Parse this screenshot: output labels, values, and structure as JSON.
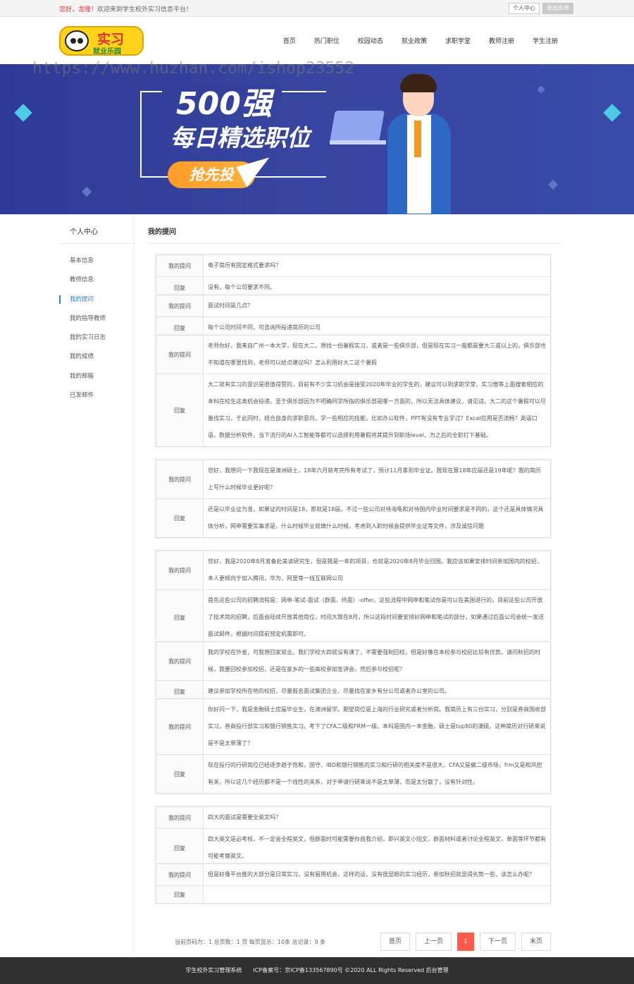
{
  "topbar": {
    "greeting_hi": "您好，",
    "greeting_name": "龙隆！",
    "greeting_text": "欢迎来到学生校外实习信息平台！",
    "personal_center": "个人中心",
    "logout": "退出系统"
  },
  "watermark": "https://www.huzhan.com/ishop23552",
  "nav": [
    "首页",
    "热门职位",
    "校园动态",
    "就业政策",
    "求职学堂",
    "教师注册",
    "学生注册"
  ],
  "banner": {
    "title1": "500强",
    "title2": "每日精选职位",
    "button": "抢先投"
  },
  "sidebar": {
    "title": "个人中心",
    "items": [
      "基本信息",
      "教师信息",
      "我的提问",
      "我的指导教师",
      "我的实习日志",
      "我的成绩",
      "我的邮箱",
      "已发邮件"
    ]
  },
  "main": {
    "title": "我的提问",
    "label_q": "我的提问",
    "label_a": "回复",
    "qa": [
      {
        "q": "电子简历有固定格式要求吗？",
        "a": "没有，每个公司要求不同。"
      },
      {
        "q": "面试时间是几点？",
        "a": "每个公司时间不同，可咨询所投递简历的公司"
      },
      {
        "q": "老师你好，我来自广州一本大学，现在大二，想找一份暑假实习，或者是一些俱乐部，但是现在实习一般都是要大三或以上的，俱乐部也不知道在哪里找到，老师可以给点建议吗？怎么利用好大二这个暑假",
        "a": "大二就有实习的意识是很值得赞的，目前有不少实习机会是接受2020年毕业的学生的，建议可以到求职学堂、实习僧等上面搜索相应的本科在校生这类机会投递。至于俱乐部因为不明确同学所指的俱乐部是哪一方面的，所以无法具体建议，请见谅。大二的这个暑假可以尽量找实习，于此同时，结合自身的求职意向，学一些相应的技能，比如办公软件，PPT有没有专业学过？Excel应用是否流畅？英语口语，数据分析软件，当下流行的AI人工智能等都可以选择利用暑假将其提升到职场level，为之后的全职打下基础。"
      },
      {
        "q": "您好，我想问一下我现在是澳洲硕士，18年六月就考完所有考试了，预计11月拿到毕业证。我现在算18年应届还是19年呢？我的简历上写什么时候毕业更好呢？",
        "a": "还是以毕业证为准，如果证的时间是18，那就是18届，不过一些公司对待海龟和对待国内毕业时间要求是不同的，这个还是具体情况具体分析，网申需要实事求是，什么时候毕业就填什么时候，考虑到入职时候会提供毕业证等文件，涉及诚信问题"
      },
      {
        "q": "您好，我是2020年8月准备赴美读研究生，但是我是一年的项目，也就是2020年8月毕业回国。我应该如果安排时间参加国内的校招，本人更倾向于加入腾讯，华为，阿里等一线互联网公司",
        "a": "首先这些公司的招聘流程是：网申-笔试-面试（群面、终面）-offer。这些流程中网申和笔试你是可以在美国进行的，目前这些公司开放了技术岗的招聘，后面会陆续开放其他岗位，时间大致在8月，所以这段时间要安排好网申和笔试的部分，如果通过后面公司会统一发送面试邮件，根据时间提前预定机票即可。"
      },
      {
        "q": "我的学校在外省，可我想回家就业。我们学校大四就没有课了，不需要强制回校。但是好像在本校参与校招比较有优势。请问秋招的时候，我要回校参加校招，还是在家乡的一些高校参加宣讲会，然后参与校招呢？",
        "a": "建议参加学校所在地的校招，尽量报名面试集团企业，尽量找在家乡有分公司或者办公室的公司。"
      },
      {
        "q": "你好问一下，我是金融硕士应届毕业生，在澳洲留学。期望岗位是上海的行业研究或者分析岗。我简历上有三份实习，分别是券商国收部实习，券商投行部实习和银行销售实习。考下了CFA二级和FRM一级。本科是国内一本金融，硕士是top80的澳硕。这种简历对行研来说是不是太单薄了？",
        "a": "现在投行的行研岗位已经逐步趋于饱和，国守、IBD和银行销售的实习和行研的相关度不是很大，CFA又是偏二级市场，frm又是和风控有关，所以这几个经历都不是一个线性的关系，对于申请行研来说不是太单薄，而是太分散了，没有针对性。"
      },
      {
        "q": "四大的面试是需要全英文吗？",
        "a": "四大英文是必考核，不一定会全程英文，但群面时可能需要你自我介绍，即兴英文小短文，群面材料或者讨论全程英文，单面等环节都有可能考察英文。"
      },
      {
        "q": "但是好像平台推的大部分是日常实习，没有留用机会，这样的话，没有很显眼的实习经历，参加秋招就显得劣势一些，该怎么办呢？",
        "a": ""
      }
    ]
  },
  "pager": {
    "info": "当前页码为：1 总页数：1 页 每页显示：10条 总记录：9 条",
    "first": "首页",
    "prev": "上一页",
    "current": "1",
    "next": "下一页",
    "last": "末页"
  },
  "footer": "学生校外实习管理系统　　ICP备案号：京ICP备133567890号 ©2020 ALL Rights Reserved 后台管理"
}
